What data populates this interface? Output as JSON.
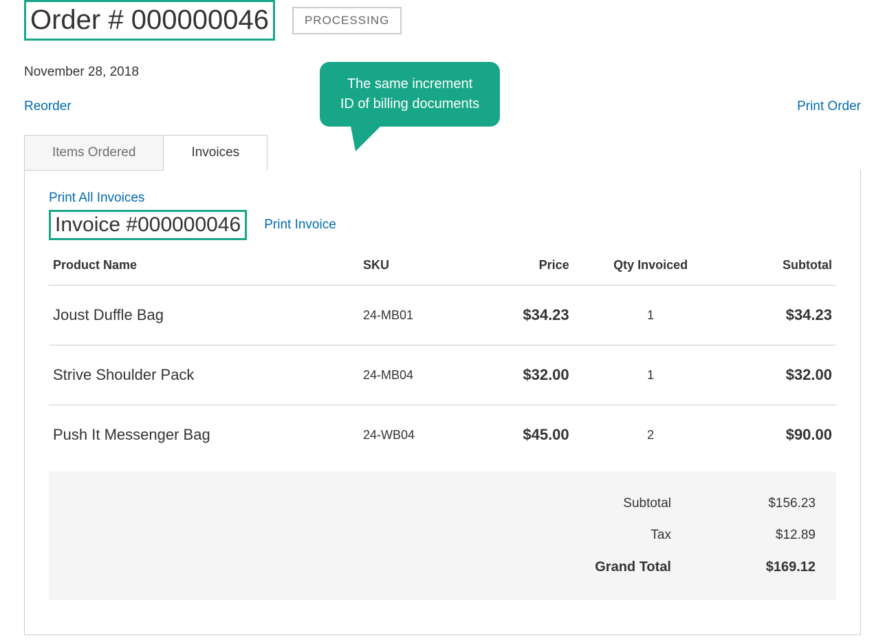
{
  "header": {
    "order_title": "Order # 000000046",
    "status": "PROCESSING",
    "date": "November 28, 2018"
  },
  "actions": {
    "reorder": "Reorder",
    "print_order": "Print Order"
  },
  "tabs": {
    "items_ordered": "Items Ordered",
    "invoices": "Invoices"
  },
  "callout": {
    "text": "The same increment ID of billing documents"
  },
  "invoice_panel": {
    "print_all": "Print All Invoices",
    "title": "Invoice #000000046",
    "print_one": "Print Invoice",
    "columns": {
      "name": "Product Name",
      "sku": "SKU",
      "price": "Price",
      "qty": "Qty Invoiced",
      "subtotal": "Subtotal"
    },
    "rows": [
      {
        "name": "Joust Duffle Bag",
        "sku": "24-MB01",
        "price": "$34.23",
        "qty": "1",
        "subtotal": "$34.23"
      },
      {
        "name": "Strive Shoulder Pack",
        "sku": "24-MB04",
        "price": "$32.00",
        "qty": "1",
        "subtotal": "$32.00"
      },
      {
        "name": "Push It Messenger Bag",
        "sku": "24-WB04",
        "price": "$45.00",
        "qty": "2",
        "subtotal": "$90.00"
      }
    ],
    "totals": {
      "subtotal_label": "Subtotal",
      "subtotal_value": "$156.23",
      "tax_label": "Tax",
      "tax_value": "$12.89",
      "grand_label": "Grand Total",
      "grand_value": "$169.12"
    }
  }
}
